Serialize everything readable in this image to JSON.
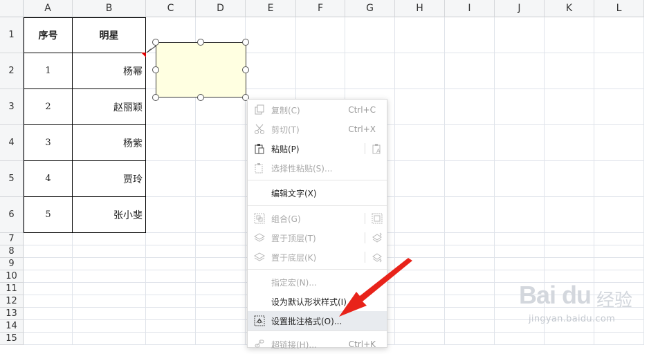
{
  "columns": [
    "A",
    "B",
    "C",
    "D",
    "E",
    "F",
    "G",
    "H",
    "I",
    "J",
    "K",
    "L"
  ],
  "rows": [
    "1",
    "2",
    "3",
    "4",
    "5",
    "6",
    "7",
    "8",
    "9",
    "10",
    "11",
    "12",
    "13",
    "14",
    "15"
  ],
  "table": {
    "headers": [
      "序号",
      "明星"
    ],
    "rows": [
      [
        "1",
        "杨幂"
      ],
      [
        "2",
        "赵丽颖"
      ],
      [
        "3",
        "杨紫"
      ],
      [
        "4",
        "贾玲"
      ],
      [
        "5",
        "张小斐"
      ]
    ]
  },
  "context_menu": {
    "items": [
      {
        "label": "复制(C)",
        "shortcut": "Ctrl+C",
        "icon": "copy-icon",
        "disabled": true
      },
      {
        "label": "剪切(T)",
        "shortcut": "Ctrl+X",
        "icon": "cut-icon",
        "disabled": true
      },
      {
        "label": "粘贴(P)",
        "shortcut": "",
        "icon": "paste-icon",
        "disabled": false
      },
      {
        "label": "选择性粘贴(S)...",
        "shortcut": "",
        "icon": "paste-special-icon",
        "disabled": true
      },
      {
        "label": "编辑文字(X)",
        "shortcut": "",
        "icon": "",
        "disabled": false
      },
      {
        "label": "组合(G)",
        "shortcut": "",
        "icon": "group-icon",
        "disabled": true
      },
      {
        "label": "置于顶层(T)",
        "shortcut": "",
        "icon": "bring-front-icon",
        "disabled": true
      },
      {
        "label": "置于底层(K)",
        "shortcut": "",
        "icon": "send-back-icon",
        "disabled": true
      },
      {
        "label": "指定宏(N)...",
        "shortcut": "",
        "icon": "",
        "disabled": true
      },
      {
        "label": "设为默认形状样式(I)",
        "shortcut": "",
        "icon": "",
        "disabled": false
      },
      {
        "label": "设置批注格式(O)...",
        "shortcut": "",
        "icon": "format-comment-icon",
        "disabled": false
      },
      {
        "label": "超链接(H)...",
        "shortcut": "Ctrl+K",
        "icon": "hyperlink-icon",
        "disabled": true
      }
    ]
  },
  "watermark": {
    "logo": "Bai du",
    "text": "经验",
    "url": "jingyan.baidu.com"
  },
  "colors": {
    "comment_fill": "#ffffe1",
    "highlight": "#e8ebef",
    "arrow": "#e8231a",
    "grid": "#dfe3ea"
  }
}
